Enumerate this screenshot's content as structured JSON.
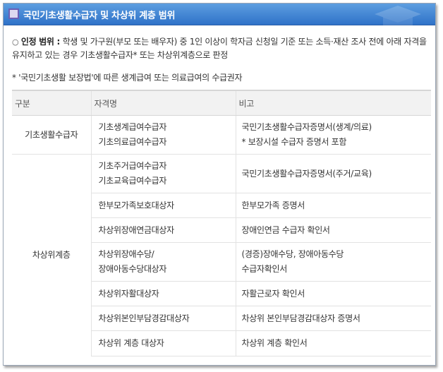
{
  "header": {
    "title": "국민기초생활수급자 및 차상위 계층 범위"
  },
  "criteria": {
    "bullet": "○",
    "label": "인정 범위 :",
    "text": "학생 및 가구원(부모 또는 배우자) 중 1인 이상이 학자금 신청일 기준 또는 소득·재산 조사 전에 아래 자격을 유지하고 있는 경우 기초생활수급자* 또는 차상위계층으로 판정"
  },
  "footnote": "* '국민기초생활 보장법'에 따른 생계급여 또는 의료급여의 수급권자",
  "table": {
    "headers": [
      "구분",
      "자격명",
      "비고"
    ],
    "group1": {
      "category": "기초생활수급자",
      "rows": [
        {
          "name": [
            "기초생계급여수급자",
            "기초의료급여수급자"
          ],
          "note": [
            "국민기초생활수급자증명서(생계/의료)",
            "* 보장시설 수급자 증명서 포함"
          ]
        }
      ]
    },
    "group2": {
      "category": "차상위계층",
      "rows": [
        {
          "name": [
            "기초주거급여수급자",
            "기초교육급여수급자"
          ],
          "note": [
            "국민기초생활수급자증명서(주거/교육)"
          ]
        },
        {
          "name": [
            "한부모가족보호대상자"
          ],
          "note": [
            "한부모가족 증명서"
          ]
        },
        {
          "name": [
            "차상위장애연금대상자"
          ],
          "note": [
            "장애인연금 수급자 확인서"
          ]
        },
        {
          "name": [
            "차상위장애수당/",
            "장애아동수당대상자"
          ],
          "note": [
            "(경증)장애수당, 장애아동수당",
            "수급자확인서"
          ]
        },
        {
          "name": [
            "차상위자활대상자"
          ],
          "note": [
            "자활근로자 확인서"
          ]
        },
        {
          "name": [
            "차상위본인부담경감대상자"
          ],
          "note": [
            "차상위 본인부담경감대상자 증명서"
          ]
        },
        {
          "name": [
            "차상위 계층 대상자"
          ],
          "note": [
            "차상위 계층 확인서"
          ]
        }
      ]
    }
  }
}
